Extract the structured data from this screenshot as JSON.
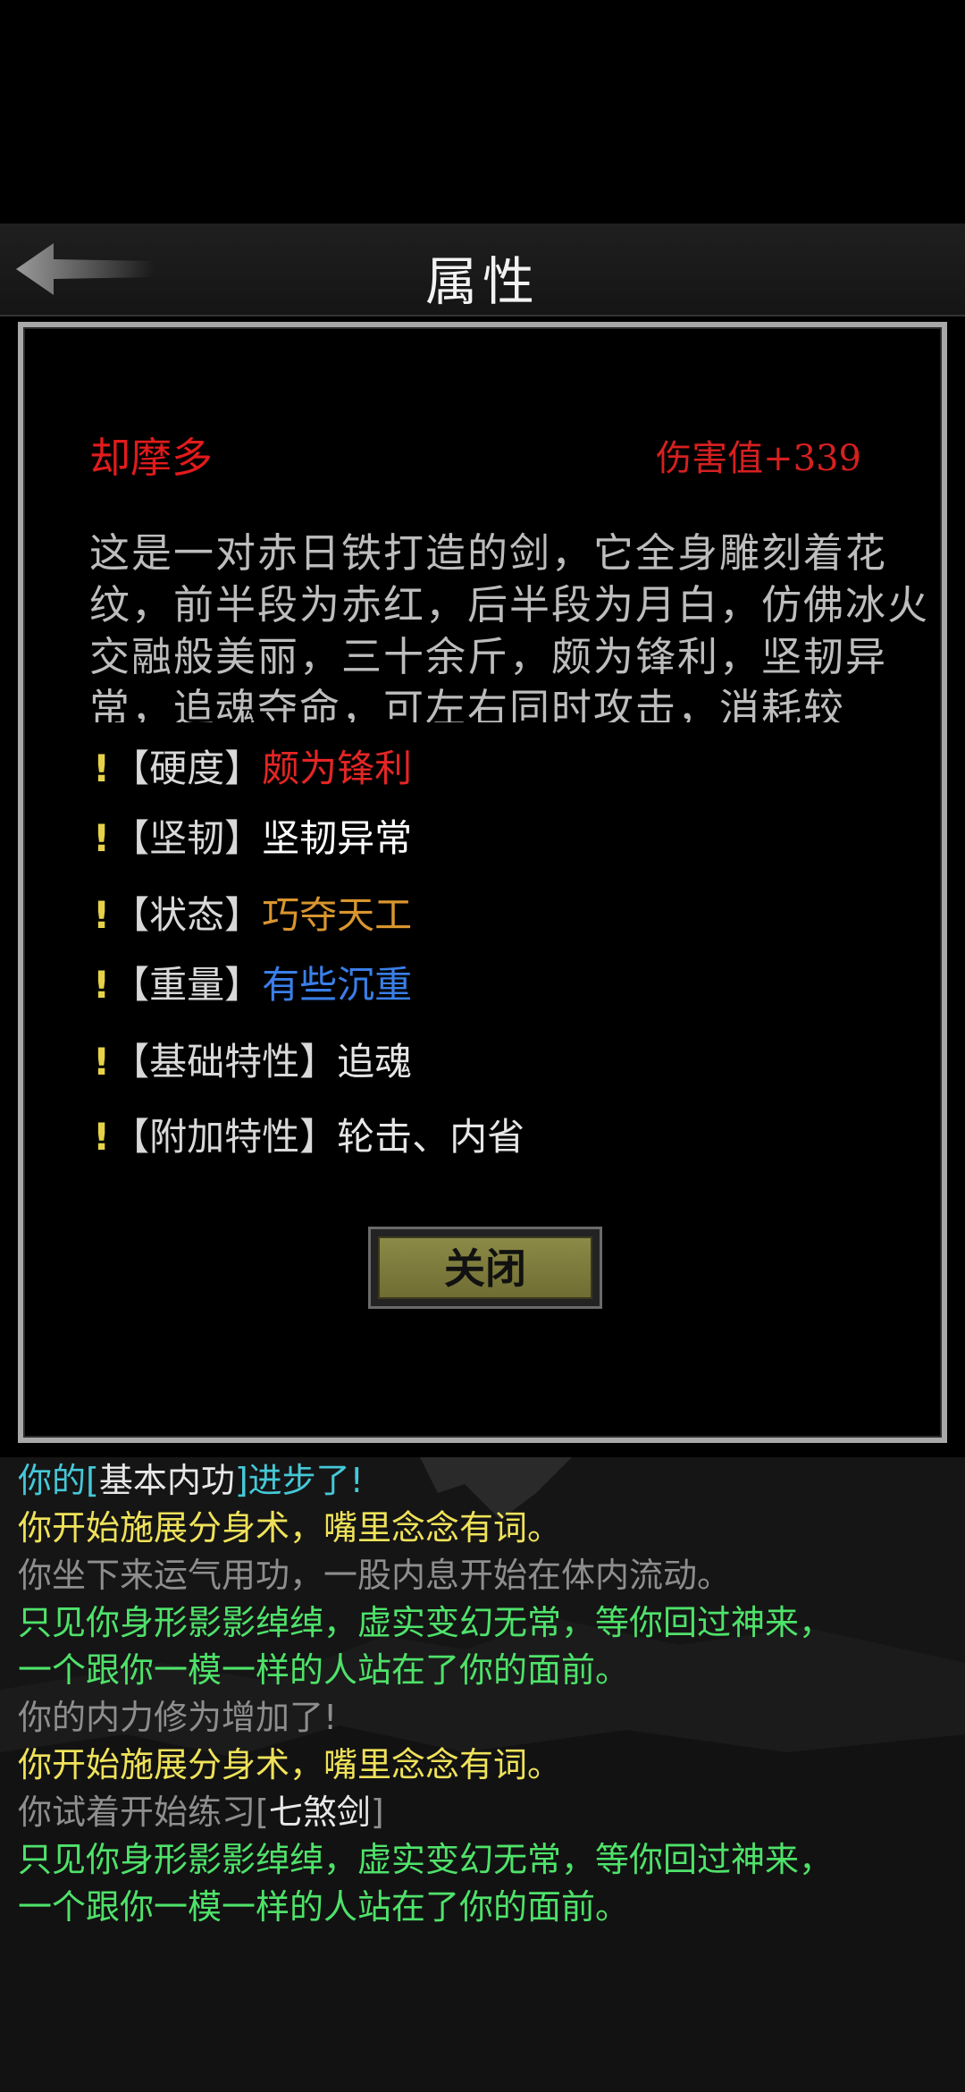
{
  "header": {
    "title": "属性"
  },
  "item": {
    "name": "却摩多",
    "damage": "伤害值+339",
    "description": "这是一对赤日铁打造的剑，它全身雕刻着花纹，前半段为赤红，后半段为月白，仿佛冰火交融般美丽，三十余斤，颇为锋利，坚韧异常，追魂夺命，可左右同时攻击，消耗较"
  },
  "attributes": [
    {
      "label": "【硬度】",
      "value": "颇为锋利",
      "color": "#e32525"
    },
    {
      "label": "【坚韧】",
      "value": "坚韧异常",
      "color": "#ffffff"
    },
    {
      "label": "【状态】",
      "value": "巧夺天工",
      "color": "#d9952e"
    },
    {
      "label": "【重量】",
      "value": "有些沉重",
      "color": "#3a7fe8"
    },
    {
      "label": "【基础特性】",
      "value": "追魂",
      "color": "#e6e6e6"
    },
    {
      "label": "【附加特性】",
      "value": "轮击、内省",
      "color": "#e6e6e6"
    }
  ],
  "excl_mark": "!",
  "close_label": "关闭",
  "log": {
    "l0": {
      "a": "你的[",
      "b": "基本内功",
      "c": "]进步了!"
    },
    "l1": "你开始施展分身术，嘴里念念有词。",
    "l2": "你坐下来运气用功，一股内息开始在体内流动。",
    "l3": "只见你身形影影绰绰，虚实变幻无常，等你回过神来，",
    "l4": "一个跟你一模一样的人站在了你的面前。",
    "l5": "你的内力修为增加了!",
    "l6": "你开始施展分身术，嘴里念念有词。",
    "l7": {
      "a": "你试着开始练习[",
      "b": "七煞剑",
      "c": "]"
    },
    "l8": "只见你身形影影绰绰，虚实变幻无常，等你回过神来，",
    "l9": "一个跟你一模一样的人站在了你的面前。"
  }
}
